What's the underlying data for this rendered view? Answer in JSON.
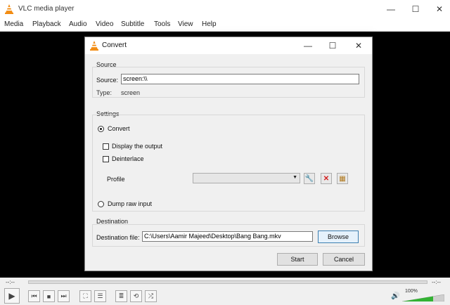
{
  "app": {
    "title": "VLC media player",
    "menu": [
      "Media",
      "Playback",
      "Audio",
      "Video",
      "Subtitle",
      "Tools",
      "View",
      "Help"
    ],
    "time_elapsed": "--:--",
    "time_total": "--:--",
    "volume_label": "100%"
  },
  "dialog": {
    "title": "Convert",
    "source": {
      "group_label": "Source",
      "source_label": "Source:",
      "source_value": "screen:\\\\",
      "type_label": "Type:",
      "type_value": "screen"
    },
    "settings": {
      "group_label": "Settings",
      "convert_label": "Convert",
      "display_output_label": "Display the output",
      "deinterlace_label": "Deinterlace",
      "profile_label": "Profile",
      "dump_raw_label": "Dump raw input"
    },
    "destination": {
      "group_label": "Destination",
      "file_label": "Destination file:",
      "file_value": "C:\\Users\\Aamir Majeed\\Desktop\\Bang Bang.mkv",
      "browse_label": "Browse"
    },
    "start_label": "Start",
    "cancel_label": "Cancel"
  },
  "colors": {
    "accent_focus": "#3c7fb1",
    "vlc_orange": "#f28c13",
    "delete_red": "#d32020",
    "volume_green": "#33b233"
  }
}
